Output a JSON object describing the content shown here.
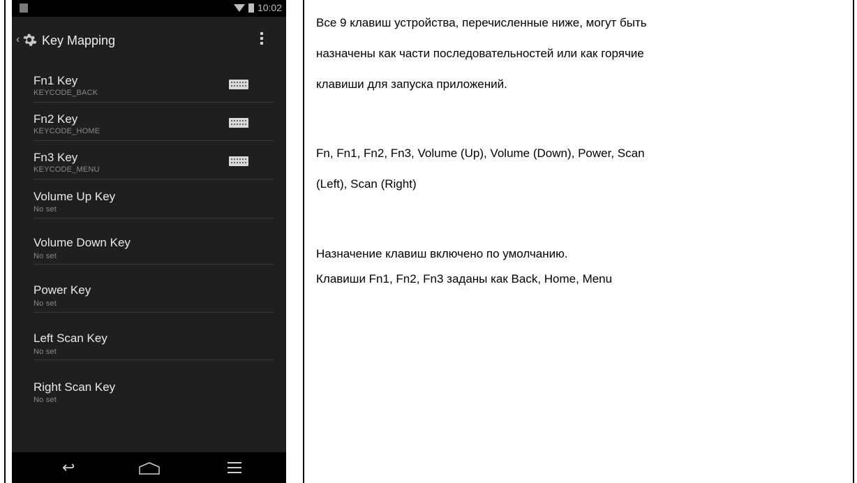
{
  "status_bar": {
    "time": "10:02"
  },
  "action_bar": {
    "back_glyph": "‹",
    "title": "Key Mapping"
  },
  "key_list": [
    {
      "title": "Fn1 Key",
      "subtitle": "KEYCODE_BACK",
      "icon": "keyboard-icon"
    },
    {
      "title": "Fn2 Key",
      "subtitle": "KEYCODE_HOME",
      "icon": "keyboard-icon"
    },
    {
      "title": "Fn3 Key",
      "subtitle": "KEYCODE_MENU",
      "icon": "keyboard-icon"
    },
    {
      "title": "Volume Up Key",
      "subtitle": "No set"
    },
    {
      "title": "Volume Down Key",
      "subtitle": "No set"
    },
    {
      "title": "Power Key",
      "subtitle": "No set"
    },
    {
      "title": "Left Scan Key",
      "subtitle": "No set"
    },
    {
      "title": "Right Scan Key",
      "subtitle": "No set"
    }
  ],
  "nav_bar": {
    "back_glyph": "↩"
  },
  "description": {
    "line1": "Все 9 клавиш устройства, перечисленные ниже, могут быть",
    "line2": "назначены как части последовательностей или как горячие",
    "line3": "клавиши для запуска приложений.",
    "line4": "Fn, Fn1, Fn2, Fn3, Volume (Up), Volume (Down), Power, Scan",
    "line5": "(Left), Scan (Right)",
    "line6": "Назначение клавиш включено по умолчанию.",
    "line7": "Клавиши Fn1, Fn2, Fn3 заданы как Back, Home, Menu"
  },
  "colors": {
    "phone_bg": "#1e1f21",
    "status_bar": "#000000",
    "text_primary": "#eaeaea",
    "text_secondary": "#8a8a8a"
  }
}
